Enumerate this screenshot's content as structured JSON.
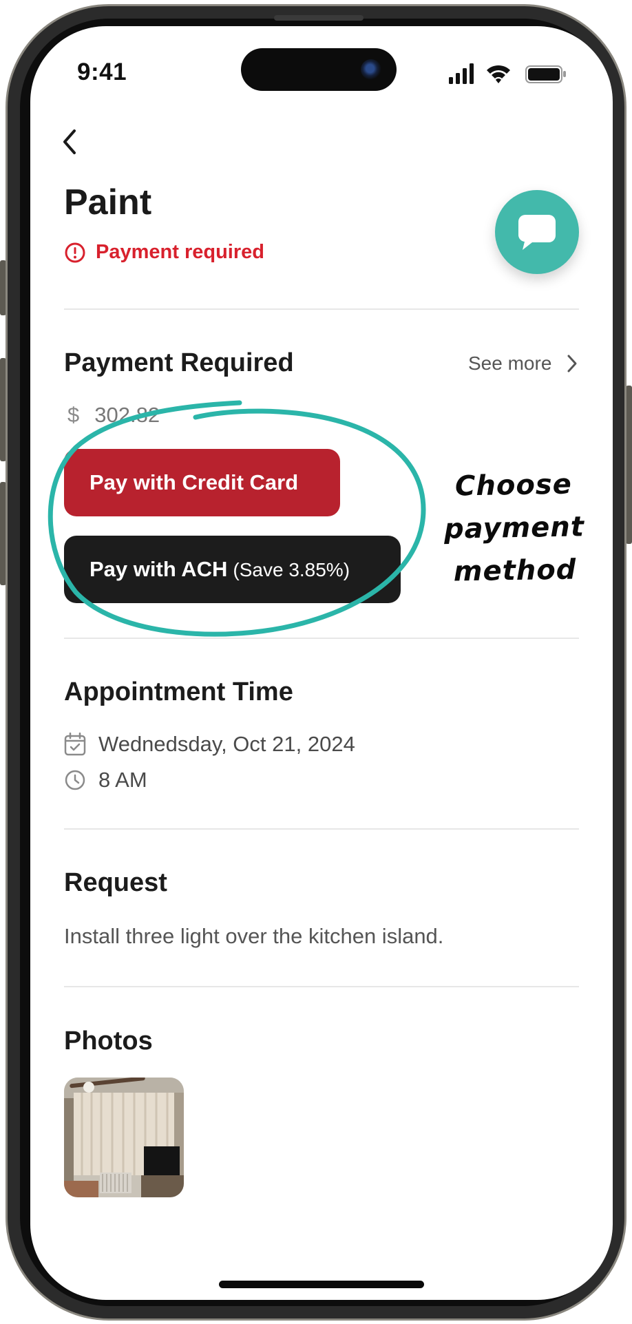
{
  "status_bar": {
    "time": "9:41",
    "icons": [
      "cellular-signal-icon",
      "wifi-icon",
      "battery-icon"
    ]
  },
  "header": {
    "back_icon": "chevron-left-icon",
    "title": "Paint",
    "alert_text": "Payment required",
    "alert_icon": "exclamation-circle-icon",
    "chat_icon": "chat-bubble-icon"
  },
  "payment": {
    "section_title": "Payment Required",
    "see_more_label": "See more",
    "currency_symbol": "$",
    "amount": "302.82",
    "credit_card_label": "Pay with Credit Card",
    "ach_label": "Pay with ACH",
    "ach_savings": "(Save 3.85%)"
  },
  "annotation": {
    "lines": [
      "Choose",
      "payment",
      "method"
    ]
  },
  "appointment": {
    "section_title": "Appointment Time",
    "date": "Wednedsday, Oct 21, 2024",
    "time": "8 AM"
  },
  "request": {
    "section_title": "Request",
    "text": "Install three light over the kitchen island."
  },
  "photos": {
    "section_title": "Photos"
  },
  "colors": {
    "accent_teal": "#43b9ab",
    "alert_red": "#d8212d",
    "credit_card_button": "#b8222e",
    "ach_button": "#1c1c1c"
  }
}
